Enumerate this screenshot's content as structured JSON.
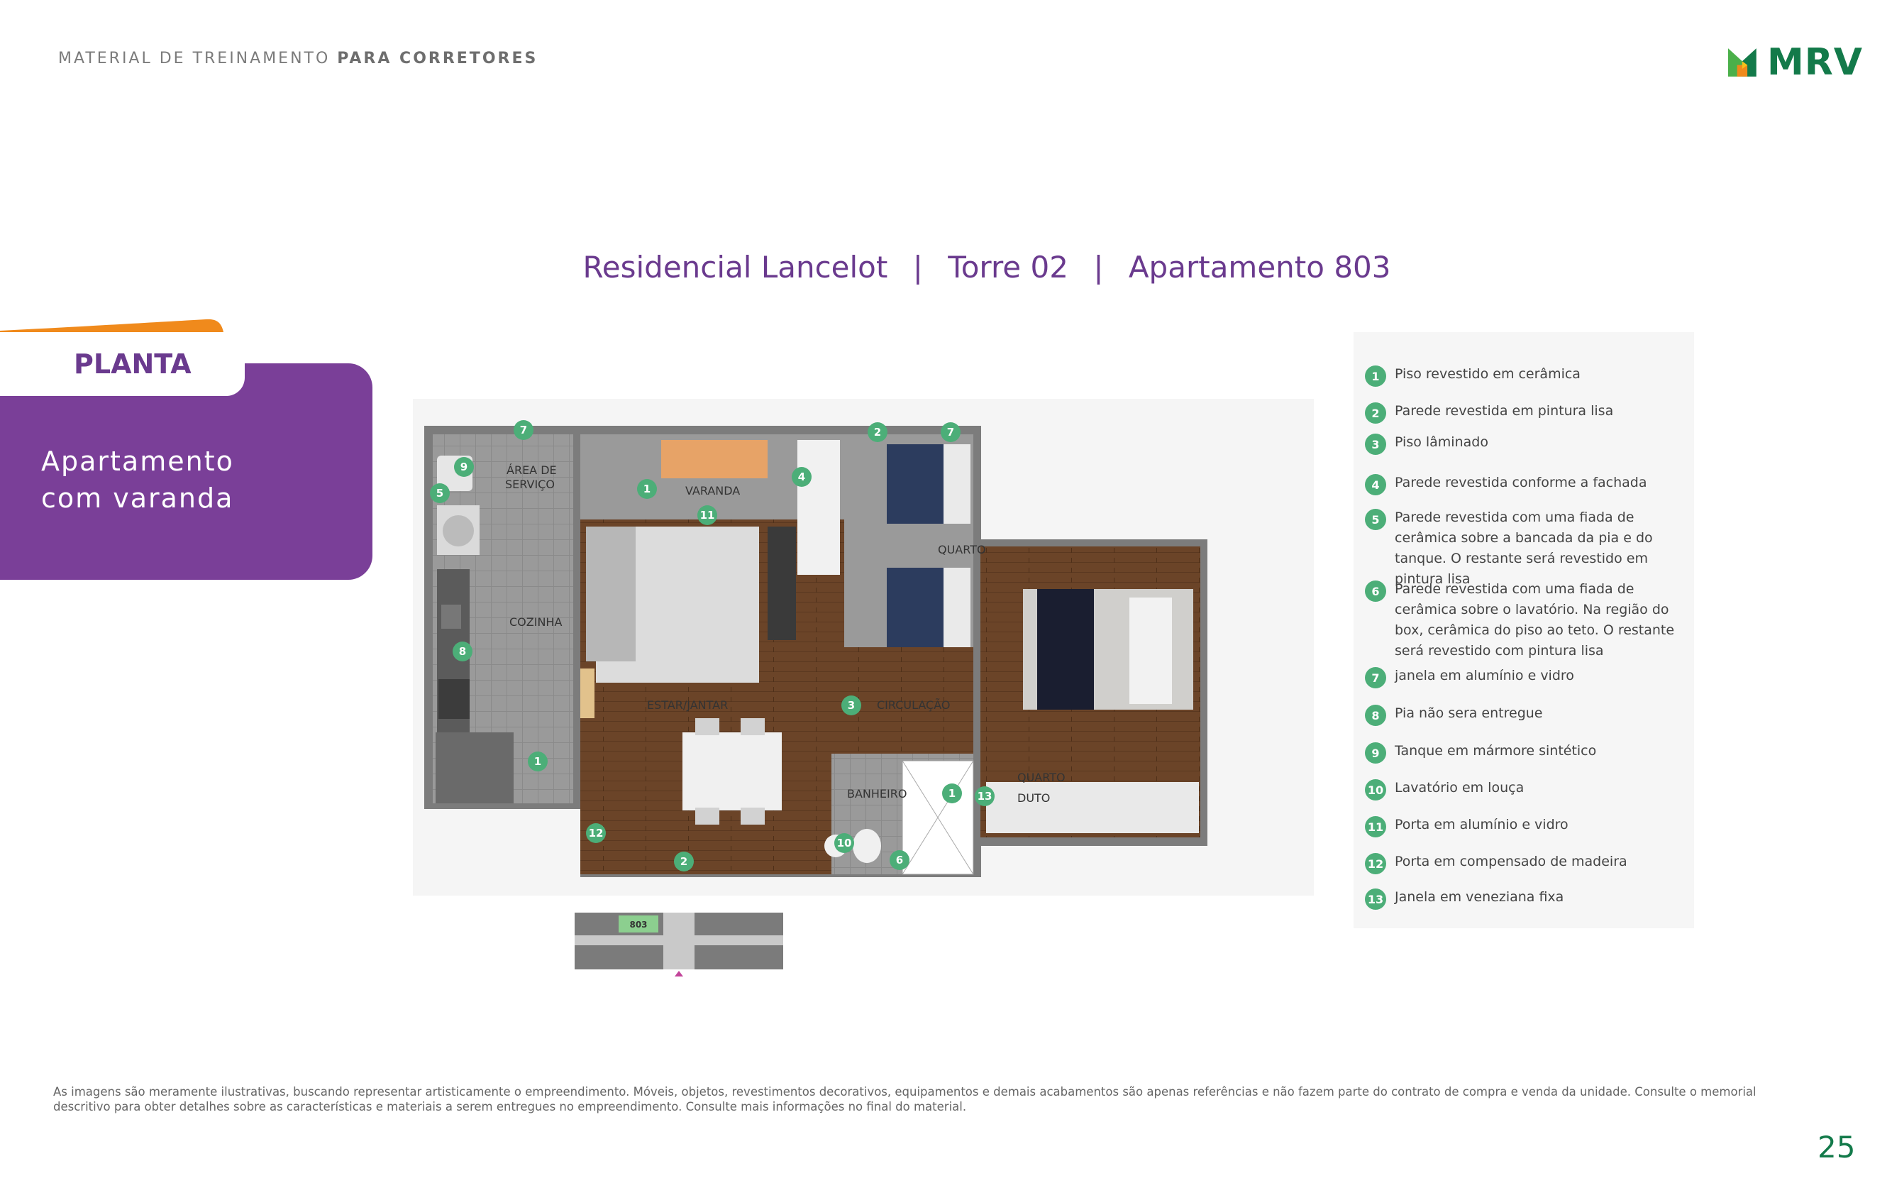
{
  "header": {
    "prefix": "MATERIAL DE TREINAMENTO",
    "bold": "PARA CORRETORES"
  },
  "logo": {
    "text": "MRV",
    "colors": {
      "green": "#137a4a",
      "orange": "#f08a1c",
      "yellow": "#f7c21a"
    }
  },
  "title": {
    "part1": "Residencial Lancelot",
    "separator": "|",
    "part2": "Torre 02",
    "part3": "Apartamento 803"
  },
  "section": {
    "tab": "PLANTA",
    "line1": "Apartamento",
    "line2": "com varanda"
  },
  "plan": {
    "rooms": {
      "area_servico_1": "ÁREA DE",
      "area_servico_2": "SERVIÇO",
      "varanda": "VARANDA",
      "cozinha": "COZINHA",
      "quarto1": "QUARTO",
      "quarto2": "QUARTO",
      "estar": "ESTAR/JANTAR",
      "circulacao": "CIRCULAÇÃO",
      "banheiro": "BANHEIRO",
      "duto": "DUTO"
    },
    "markers": [
      "7",
      "9",
      "5",
      "1",
      "11",
      "4",
      "2",
      "7",
      "8",
      "1",
      "3",
      "1",
      "13",
      "12",
      "2",
      "10",
      "6"
    ],
    "keyplan_label": "803"
  },
  "legend": [
    {
      "num": "1",
      "text": "Piso revestido em cerâmica"
    },
    {
      "num": "2",
      "text": "Parede revestida em pintura lisa"
    },
    {
      "num": "3",
      "text": "Piso lâminado"
    },
    {
      "num": "4",
      "text": "Parede revestida conforme a fachada"
    },
    {
      "num": "5",
      "text": "Parede revestida com uma fiada de cerâmica sobre a bancada da pia e do tanque. O restante será revestido em pintura lisa"
    },
    {
      "num": "6",
      "text": "Parede revestida com uma fiada de cerâmica sobre o lavatório. Na região do box, cerâmica do piso ao teto. O restante será revestido com pintura lisa"
    },
    {
      "num": "7",
      "text": "janela em alumínio e vidro"
    },
    {
      "num": "8",
      "text": "Pia não sera entregue"
    },
    {
      "num": "9",
      "text": "Tanque em mármore sintético"
    },
    {
      "num": "10",
      "text": "Lavatório em louça"
    },
    {
      "num": "11",
      "text": "Porta em alumínio e vidro"
    },
    {
      "num": "12",
      "text": "Porta em compensado de madeira"
    },
    {
      "num": "13",
      "text": "Janela em veneziana fixa"
    }
  ],
  "disclaimer": "As imagens são meramente ilustrativas, buscando representar artisticamente o empreendimento. Móveis, objetos, revestimentos decorativos, equipamentos e demais acabamentos são apenas referências e não fazem parte do contrato de compra e venda da unidade. Consulte o memorial descritivo para obter detalhes sobre as características e materiais a serem entregues no empreendimento. Consulte mais informações no final do material.",
  "page_number": "25"
}
